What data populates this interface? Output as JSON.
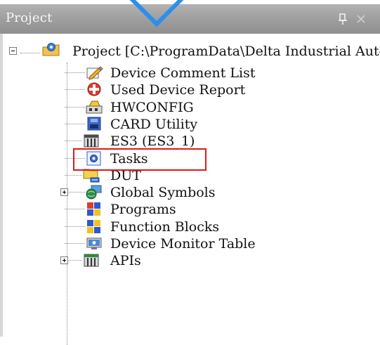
{
  "panel": {
    "title": "Project",
    "pin_icon": "pin-icon",
    "close_icon": "close-icon"
  },
  "tree": {
    "root": {
      "label": "Project [C:\\ProgramData\\Delta Industrial Autor",
      "icon": "project-folder-icon",
      "expanded": true
    },
    "items": [
      {
        "label": "Device Comment List",
        "icon": "pencil-list-icon"
      },
      {
        "label": "Used Device Report",
        "icon": "device-report-icon"
      },
      {
        "label": "HWCONFIG",
        "icon": "hardware-config-icon"
      },
      {
        "label": "CARD Utility",
        "icon": "card-utility-icon"
      },
      {
        "label": "ES3  (ES3_1)",
        "icon": "plc-device-icon",
        "highlighted": true
      },
      {
        "label": "Tasks",
        "icon": "tasks-gear-icon"
      },
      {
        "label": "DUT",
        "icon": "dut-icon"
      },
      {
        "label": "Global Symbols",
        "icon": "global-symbols-icon",
        "expandable": true
      },
      {
        "label": "Programs",
        "icon": "programs-icon"
      },
      {
        "label": "Function Blocks",
        "icon": "function-blocks-icon"
      },
      {
        "label": "Device Monitor Table",
        "icon": "monitor-table-icon"
      },
      {
        "label": "APIs",
        "icon": "apis-icon",
        "expandable": true
      }
    ]
  },
  "colors": {
    "titlebar": "#9d9d9d",
    "highlight_border": "#e01919",
    "callout_arrow": "#2e8ee8"
  }
}
